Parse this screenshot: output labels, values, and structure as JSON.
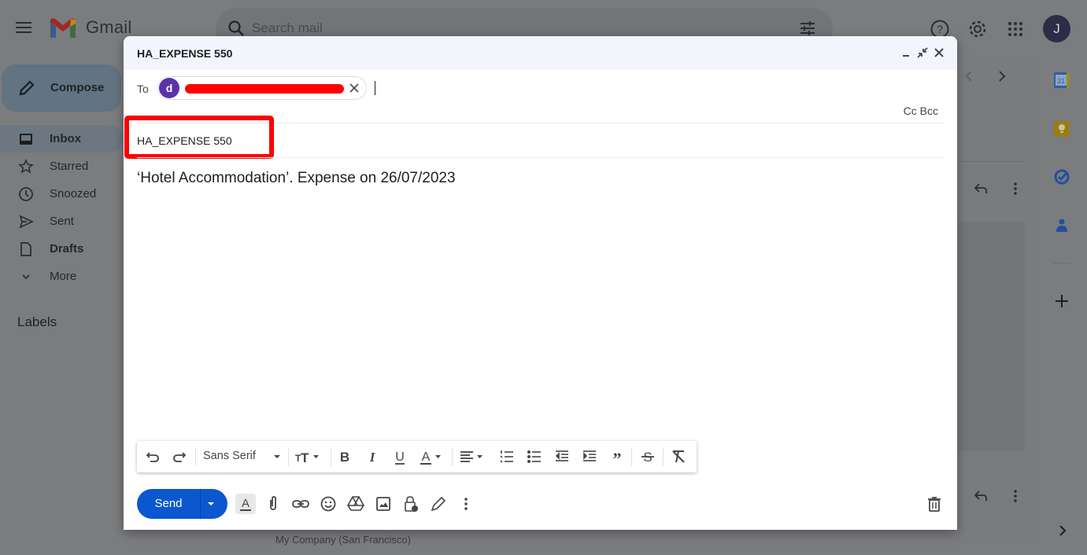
{
  "app": {
    "logo_text": "Gmail",
    "search_placeholder": "Search mail",
    "account_initial": "J"
  },
  "sidebar": {
    "compose_label": "Compose",
    "items": [
      {
        "label": "Inbox",
        "icon": "inbox-icon",
        "active": true,
        "bold": true
      },
      {
        "label": "Starred",
        "icon": "star-icon"
      },
      {
        "label": "Snoozed",
        "icon": "clock-icon"
      },
      {
        "label": "Sent",
        "icon": "send-icon"
      },
      {
        "label": "Drafts",
        "icon": "draft-icon",
        "bold": true
      },
      {
        "label": "More",
        "icon": "chevron-down-icon"
      }
    ],
    "labels_header": "Labels"
  },
  "background": {
    "footer_text": "My Company (San Francisco)"
  },
  "compose": {
    "window_title": "HA_EXPENSE 550",
    "to_label": "To",
    "recipient_initial": "d",
    "recipient_redacted": true,
    "cc_label": "Cc",
    "bcc_label": "Bcc",
    "subject_value": "HA_EXPENSE 550",
    "body_text": "‘Hotel Accommodation’. Expense on 26/07/2023",
    "font_family_selected": "Sans Serif",
    "send_label": "Send"
  },
  "colors": {
    "send_button": "#0b57d0",
    "highlight": "#ff0000",
    "recipient_avatar": "#5b32a8",
    "header_bg": "#f2f6fc"
  }
}
